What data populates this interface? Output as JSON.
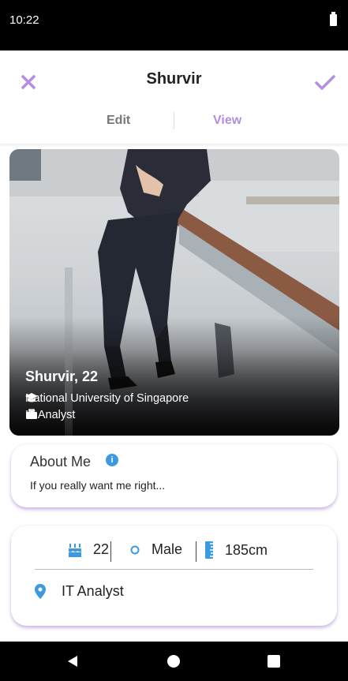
{
  "status_bar": {
    "time": "10:22"
  },
  "header": {
    "title": "Shurvir",
    "close_icon": "close-icon",
    "confirm_icon": "check-icon"
  },
  "tabs": [
    {
      "label": "Edit",
      "active": false
    },
    {
      "label": "View",
      "active": true
    }
  ],
  "profile": {
    "name_age": "Shurvir, 22",
    "school": "National University of Singapore",
    "job": "IT Analyst"
  },
  "about": {
    "title": "About Me",
    "text": "If you really want me right..."
  },
  "stats": {
    "age": "22",
    "gender": "Male",
    "height": "185cm",
    "job": "IT Analyst"
  },
  "colors": {
    "accent": "#b38ddf",
    "icon_blue": "#3b9ae0",
    "card_shadow": "#966ec8"
  }
}
